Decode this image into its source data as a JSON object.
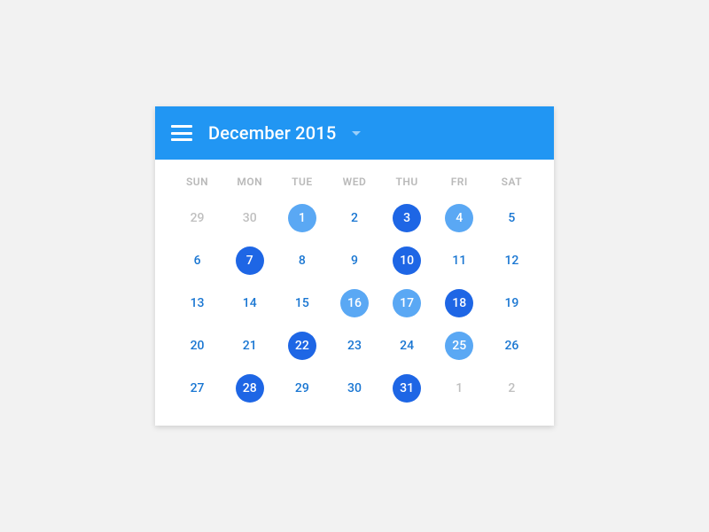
{
  "colors": {
    "header_bg": "#2196f3",
    "header_fg": "#ffffff",
    "day_current": "#1976d2",
    "day_out": "#bfbfbf",
    "mark_dark": "#1e66e5",
    "mark_light": "#5aa8f4",
    "dow_fg": "#b9b9b9",
    "page_bg": "#f2f2f2",
    "card_bg": "#ffffff"
  },
  "header": {
    "title": "December 2015"
  },
  "dow": [
    "SUN",
    "MON",
    "TUE",
    "WED",
    "THU",
    "FRI",
    "SAT"
  ],
  "weeks": [
    [
      {
        "n": 29,
        "month": "prev"
      },
      {
        "n": 30,
        "month": "prev"
      },
      {
        "n": 1,
        "month": "curr",
        "mark": "light"
      },
      {
        "n": 2,
        "month": "curr"
      },
      {
        "n": 3,
        "month": "curr",
        "mark": "dark"
      },
      {
        "n": 4,
        "month": "curr",
        "mark": "light"
      },
      {
        "n": 5,
        "month": "curr"
      }
    ],
    [
      {
        "n": 6,
        "month": "curr"
      },
      {
        "n": 7,
        "month": "curr",
        "mark": "dark"
      },
      {
        "n": 8,
        "month": "curr"
      },
      {
        "n": 9,
        "month": "curr"
      },
      {
        "n": 10,
        "month": "curr",
        "mark": "dark"
      },
      {
        "n": 11,
        "month": "curr"
      },
      {
        "n": 12,
        "month": "curr"
      }
    ],
    [
      {
        "n": 13,
        "month": "curr"
      },
      {
        "n": 14,
        "month": "curr"
      },
      {
        "n": 15,
        "month": "curr"
      },
      {
        "n": 16,
        "month": "curr",
        "mark": "light"
      },
      {
        "n": 17,
        "month": "curr",
        "mark": "light"
      },
      {
        "n": 18,
        "month": "curr",
        "mark": "dark"
      },
      {
        "n": 19,
        "month": "curr"
      }
    ],
    [
      {
        "n": 20,
        "month": "curr"
      },
      {
        "n": 21,
        "month": "curr"
      },
      {
        "n": 22,
        "month": "curr",
        "mark": "dark"
      },
      {
        "n": 23,
        "month": "curr"
      },
      {
        "n": 24,
        "month": "curr"
      },
      {
        "n": 25,
        "month": "curr",
        "mark": "light"
      },
      {
        "n": 26,
        "month": "curr"
      }
    ],
    [
      {
        "n": 27,
        "month": "curr"
      },
      {
        "n": 28,
        "month": "curr",
        "mark": "dark"
      },
      {
        "n": 29,
        "month": "curr"
      },
      {
        "n": 30,
        "month": "curr"
      },
      {
        "n": 31,
        "month": "curr",
        "mark": "dark"
      },
      {
        "n": 1,
        "month": "next"
      },
      {
        "n": 2,
        "month": "next"
      }
    ]
  ]
}
